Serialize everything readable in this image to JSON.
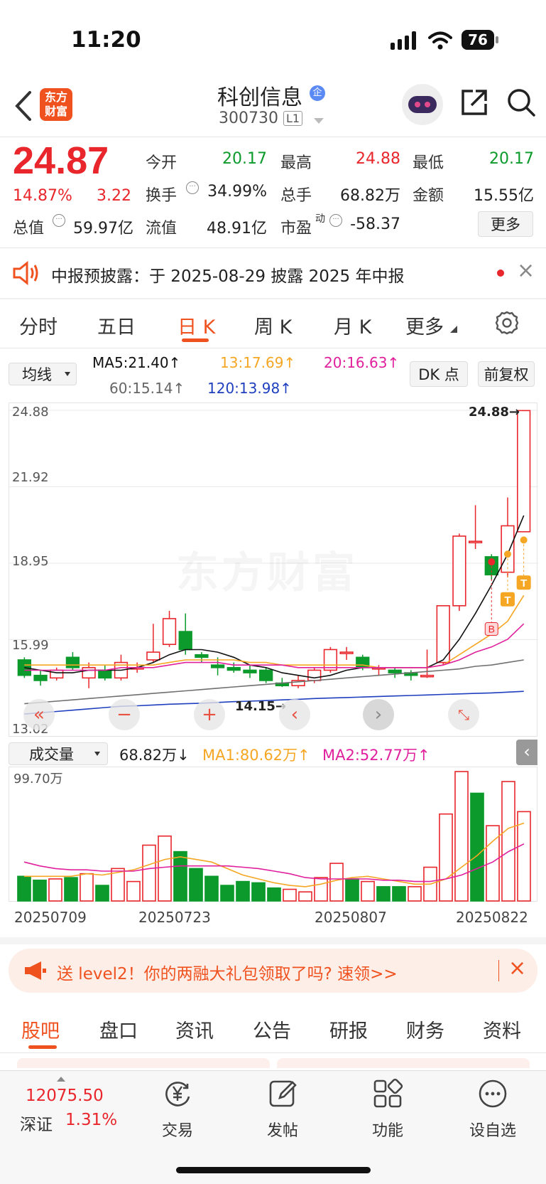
{
  "status_bar": {
    "time": "11:20",
    "battery": "76"
  },
  "header": {
    "logo_line1": "东方",
    "logo_line2": "财富",
    "stock_name": "科创信息",
    "badge": "企",
    "stock_code": "300730",
    "level": "L1"
  },
  "quote": {
    "price": "24.87",
    "change_pct": "14.87%",
    "change_amt": "3.22",
    "row1": [
      {
        "label": "今开",
        "value": "20.17",
        "color": "green"
      },
      {
        "label": "最高",
        "value": "24.88",
        "color": "red"
      },
      {
        "label": "最低",
        "value": "20.17",
        "color": "green"
      }
    ],
    "row2": [
      {
        "label": "换手",
        "value": "34.99%"
      },
      {
        "label": "总手",
        "value": "68.82万"
      },
      {
        "label": "金额",
        "value": "15.55亿"
      }
    ],
    "row3": [
      {
        "label": "总值",
        "value": "59.97亿"
      },
      {
        "label": "流值",
        "value": "48.91亿"
      },
      {
        "label": "市盈",
        "sup": "动",
        "value": "-58.37"
      }
    ],
    "more_button": "更多"
  },
  "notice": {
    "text": "中报预披露：于 2025-08-29 披露 2025 年中报"
  },
  "chart_tabs": [
    "分时",
    "五日",
    "日 K",
    "周 K",
    "月 K",
    "更多"
  ],
  "active_tab": "日 K",
  "ma_bar": {
    "selector": "均线",
    "ma5": "MA5:21.40",
    "ma13": "13:17.69",
    "ma20": "20:16.63",
    "ma60": "60:15.14",
    "ma120": "120:13.98",
    "dk_button": "DK 点",
    "fq_button": "前复权"
  },
  "kline": {
    "y_ticks": [
      "24.88",
      "21.92",
      "18.95",
      "15.99",
      "13.02"
    ],
    "high_label": "24.88→",
    "low_label": "14.15→",
    "watermark": "东方财富",
    "signal_b": "B",
    "signal_t": "T"
  },
  "volume": {
    "selector": "成交量",
    "vol": "68.82万",
    "ma1": "MA1:80.62万",
    "ma2": "MA2:52.77万",
    "max_label": "99.70万",
    "dates": [
      "20250709",
      "20250723",
      "20250807",
      "20250822"
    ]
  },
  "promo": {
    "text": "送 level2！你的两融大礼包领取了吗? 速领>>"
  },
  "bottom_tabs": [
    "股吧",
    "盘口",
    "资讯",
    "公告",
    "研报",
    "财务",
    "资料"
  ],
  "toolbar": {
    "index_value": "12075.50",
    "index_name": "深证",
    "index_pct": "1.31%",
    "items": [
      "交易",
      "发帖",
      "功能",
      "设自选"
    ]
  },
  "colors": {
    "up": "#e8262b",
    "down": "#0b9a2b",
    "accent": "#ff5a1f",
    "ma5": "#111111",
    "ma13": "#f5a623",
    "ma20": "#e0209c",
    "ma60": "#707070",
    "ma120": "#1f3fbf"
  },
  "chart_data": {
    "type": "candlestick",
    "ylim": [
      13.02,
      24.88
    ],
    "candles": [
      {
        "o": 15.2,
        "c": 14.6,
        "h": 15.3,
        "l": 14.5
      },
      {
        "o": 14.6,
        "c": 14.4,
        "h": 14.8,
        "l": 14.2
      },
      {
        "o": 14.5,
        "c": 14.8,
        "h": 14.9,
        "l": 14.4
      },
      {
        "o": 15.3,
        "c": 14.9,
        "h": 15.5,
        "l": 14.8
      },
      {
        "o": 14.5,
        "c": 14.9,
        "h": 15.1,
        "l": 14.1
      },
      {
        "o": 14.8,
        "c": 14.5,
        "h": 15.0,
        "l": 14.4
      },
      {
        "o": 14.5,
        "c": 15.1,
        "h": 15.4,
        "l": 14.4
      },
      {
        "o": 14.9,
        "c": 14.9,
        "h": 15.1,
        "l": 14.7
      },
      {
        "o": 15.2,
        "c": 15.5,
        "h": 16.6,
        "l": 15.1
      },
      {
        "o": 15.8,
        "c": 16.8,
        "h": 17.1,
        "l": 15.7
      },
      {
        "o": 16.3,
        "c": 15.6,
        "h": 17.0,
        "l": 15.4
      },
      {
        "o": 15.4,
        "c": 15.3,
        "h": 15.5,
        "l": 15.1
      },
      {
        "o": 15.0,
        "c": 14.9,
        "h": 15.3,
        "l": 14.6
      },
      {
        "o": 14.9,
        "c": 14.8,
        "h": 15.1,
        "l": 14.7
      },
      {
        "o": 14.8,
        "c": 14.7,
        "h": 15.0,
        "l": 14.5
      },
      {
        "o": 14.8,
        "c": 14.4,
        "h": 14.9,
        "l": 14.3
      },
      {
        "o": 14.3,
        "c": 14.2,
        "h": 14.5,
        "l": 14.15
      },
      {
        "o": 14.2,
        "c": 14.4,
        "h": 14.6,
        "l": 14.1
      },
      {
        "o": 14.4,
        "c": 14.8,
        "h": 14.9,
        "l": 14.3
      },
      {
        "o": 14.8,
        "c": 15.6,
        "h": 15.7,
        "l": 14.7
      },
      {
        "o": 15.5,
        "c": 15.5,
        "h": 15.7,
        "l": 15.2
      },
      {
        "o": 15.3,
        "c": 14.9,
        "h": 15.4,
        "l": 14.8
      },
      {
        "o": 14.9,
        "c": 14.9,
        "h": 15.0,
        "l": 14.6
      },
      {
        "o": 14.8,
        "c": 14.7,
        "h": 14.9,
        "l": 14.5
      },
      {
        "o": 14.7,
        "c": 14.6,
        "h": 14.8,
        "l": 14.4
      },
      {
        "o": 14.6,
        "c": 14.6,
        "h": 15.6,
        "l": 14.5
      },
      {
        "o": 15.1,
        "c": 17.3,
        "h": 17.3,
        "l": 15.0
      },
      {
        "o": 17.3,
        "c": 20.0,
        "h": 20.1,
        "l": 17.1
      },
      {
        "o": 19.8,
        "c": 19.8,
        "h": 21.2,
        "l": 19.5
      },
      {
        "o": 19.2,
        "c": 18.5,
        "h": 19.3,
        "l": 18.3
      },
      {
        "o": 18.6,
        "c": 20.4,
        "h": 21.5,
        "l": 18.4
      },
      {
        "o": 20.17,
        "c": 24.87,
        "h": 24.88,
        "l": 20.17
      }
    ],
    "ma": [
      {
        "name": "MA5",
        "values": [
          14.9,
          14.8,
          14.7,
          14.7,
          14.8,
          14.8,
          14.8,
          14.9,
          15.1,
          15.4,
          15.6,
          15.6,
          15.5,
          15.3,
          15.0,
          14.9,
          14.7,
          14.6,
          14.5,
          14.6,
          14.8,
          14.9,
          14.9,
          14.9,
          14.9,
          14.9,
          15.2,
          16.0,
          17.0,
          18.1,
          19.3,
          20.8
        ]
      },
      {
        "name": "MA13",
        "values": [
          15.0,
          15.0,
          15.0,
          15.0,
          15.0,
          15.0,
          15.0,
          15.0,
          15.0,
          15.1,
          15.2,
          15.2,
          15.2,
          15.2,
          15.1,
          15.1,
          15.0,
          15.0,
          15.0,
          15.0,
          15.0,
          15.0,
          14.9,
          14.9,
          14.9,
          14.9,
          15.0,
          15.4,
          15.8,
          16.2,
          16.7,
          17.7
        ]
      },
      {
        "name": "MA20",
        "values": [
          14.8,
          14.8,
          14.8,
          14.8,
          14.8,
          14.8,
          14.9,
          14.9,
          14.9,
          15.0,
          15.1,
          15.1,
          15.1,
          15.0,
          15.0,
          15.0,
          15.0,
          14.9,
          14.9,
          14.9,
          14.9,
          14.9,
          14.9,
          14.9,
          14.9,
          14.9,
          15.0,
          15.2,
          15.5,
          15.7,
          16.0,
          16.6
        ]
      },
      {
        "name": "MA60",
        "values": [
          13.5,
          13.55,
          13.6,
          13.65,
          13.7,
          13.75,
          13.8,
          13.85,
          13.9,
          13.95,
          14.0,
          14.05,
          14.1,
          14.15,
          14.2,
          14.25,
          14.3,
          14.35,
          14.4,
          14.45,
          14.5,
          14.55,
          14.6,
          14.65,
          14.7,
          14.75,
          14.8,
          14.85,
          14.95,
          15.0,
          15.1,
          15.2
        ]
      },
      {
        "name": "MA120",
        "values": [
          13.1,
          13.15,
          13.2,
          13.25,
          13.3,
          13.35,
          13.4,
          13.42,
          13.45,
          13.48,
          13.5,
          13.52,
          13.55,
          13.58,
          13.6,
          13.62,
          13.65,
          13.67,
          13.7,
          13.72,
          13.74,
          13.76,
          13.78,
          13.8,
          13.82,
          13.84,
          13.86,
          13.88,
          13.9,
          13.92,
          13.95,
          13.98
        ]
      }
    ],
    "volume_ylim": [
      0,
      99.7
    ],
    "volumes": [
      19,
      16,
      17,
      18,
      21,
      12,
      25,
      15,
      43,
      50,
      38,
      25,
      19,
      12,
      15,
      14,
      10,
      9,
      7,
      18,
      29,
      17,
      15,
      11,
      11,
      11,
      26,
      67,
      99.7,
      83,
      58,
      92,
      68.82
    ],
    "vol_ma": [
      {
        "name": "MA1",
        "values": [
          19,
          19,
          19,
          19,
          21,
          20,
          22,
          24,
          28,
          32,
          34,
          32,
          30,
          25,
          20,
          17,
          14,
          12,
          11,
          13,
          16,
          18,
          19,
          17,
          15,
          13,
          13,
          17,
          26,
          35,
          46,
          56,
          60
        ]
      },
      {
        "name": "MA2",
        "values": [
          30,
          27,
          25,
          24,
          24,
          23,
          23,
          23,
          25,
          26,
          27,
          27,
          27,
          27,
          26,
          25,
          23,
          21,
          18,
          17,
          17,
          17,
          17,
          16,
          16,
          15,
          15,
          17,
          20,
          25,
          30,
          38,
          44
        ]
      }
    ]
  }
}
